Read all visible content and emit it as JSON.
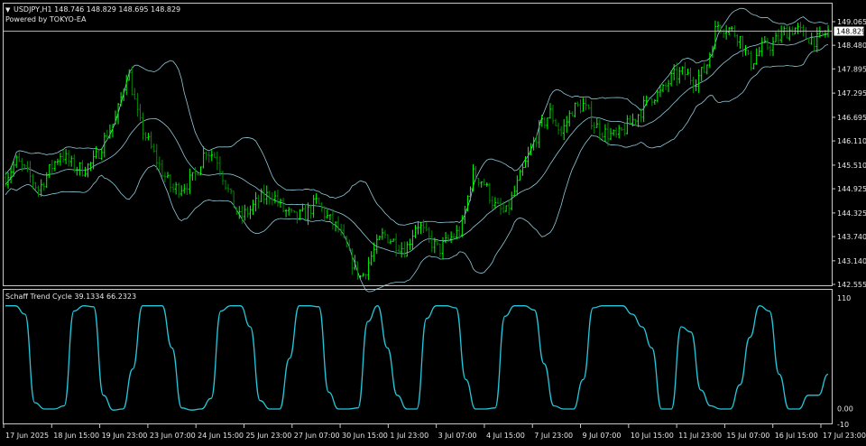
{
  "header": {
    "menu_glyph": "▼",
    "symbol_line": "USDJPY,H1  148.746 148.829 148.695 148.829",
    "powered_by": "Powered by TOKYO-EA"
  },
  "indicator": {
    "label": "Schaff Trend Cycle 39.1334 66.2323"
  },
  "colors": {
    "background": "#000000",
    "bull_bar": "#00ff00",
    "bear_bar": "#008a00",
    "bands": "#8fc9d9",
    "stc_line": "#26c6da",
    "axis": "#c8c8c8",
    "text": "#e6e6e6"
  },
  "chart_data": [
    {
      "type": "line",
      "title": "USDJPY,H1",
      "price_axis_ticks": [
        "149.065",
        "148.480",
        "147.895",
        "147.295",
        "146.695",
        "146.110",
        "145.510",
        "144.925",
        "144.325",
        "143.740",
        "143.140",
        "142.555"
      ],
      "tick_values": [
        149.065,
        148.48,
        147.895,
        147.295,
        146.695,
        146.11,
        145.51,
        144.925,
        144.325,
        143.74,
        143.14,
        142.555
      ],
      "ylim": [
        142.555,
        149.065
      ],
      "current_price_label": "148.829",
      "current_price": 148.829,
      "time_axis_labels": [
        "17 Jun 2025",
        "18 Jun 15:00",
        "19 Jun 23:00",
        "23 Jun 07:00",
        "24 Jun 15:00",
        "25 Jun 23:00",
        "27 Jun 07:00",
        "30 Jun 15:00",
        "1 Jul 23:00",
        "3 Jul 07:00",
        "4 Jul 15:00",
        "7 Jul 23:00",
        "9 Jul 07:00",
        "10 Jul 15:00",
        "11 Jul 23:00",
        "15 Jul 07:00",
        "16 Jul 15:00",
        "17 Jul 23:00"
      ],
      "series": [
        {
          "values": [
            145.2,
            145.6,
            145.3,
            144.9,
            145.4,
            145.8,
            145.5,
            145.4,
            145.6,
            146.2,
            146.7,
            147.9,
            146.6,
            146.0,
            145.4,
            144.9,
            145.0,
            145.2,
            145.9,
            145.7,
            144.9,
            144.2,
            144.4,
            144.7,
            144.8,
            144.4,
            144.2,
            144.3,
            144.6,
            144.2,
            143.9,
            143.2,
            142.7,
            143.3,
            143.8,
            143.6,
            143.4,
            144.1,
            143.7,
            143.4,
            143.7,
            143.9,
            145.3,
            145.1,
            144.5,
            144.3,
            145.0,
            145.7,
            146.4,
            146.8,
            146.3,
            146.9,
            147.0,
            146.5,
            146.3,
            146.2,
            146.5,
            146.8,
            147.2,
            147.3,
            147.7,
            147.8,
            147.6,
            147.9,
            149.0,
            148.9,
            148.7,
            148.0,
            148.4,
            148.5,
            148.8,
            148.9,
            148.7,
            148.6,
            148.83
          ]
        }
      ],
      "indicators": [
        "Bollinger Bands"
      ]
    },
    {
      "type": "line",
      "title": "Schaff Trend Cycle",
      "axis_ticks": [
        "110",
        "0.00",
        "-10"
      ],
      "ylim": [
        -10,
        110
      ],
      "series": [
        {
          "values": [
            100,
            100,
            92,
            8,
            2,
            2,
            5,
            95,
            100,
            99,
            15,
            1,
            2,
            40,
            100,
            100,
            100,
            60,
            3,
            1,
            2,
            12,
            95,
            100,
            100,
            80,
            10,
            2,
            2,
            50,
            100,
            100,
            99,
            18,
            2,
            2,
            3,
            85,
            100,
            60,
            15,
            2,
            2,
            88,
            100,
            100,
            98,
            30,
            2,
            2,
            3,
            90,
            100,
            100,
            96,
            45,
            5,
            2,
            2,
            30,
            98,
            100,
            100,
            100,
            92,
            80,
            60,
            2,
            2,
            80,
            75,
            20,
            5,
            2,
            2,
            25,
            70,
            100,
            95,
            35,
            2,
            2,
            15,
            15,
            35
          ]
        }
      ]
    }
  ]
}
